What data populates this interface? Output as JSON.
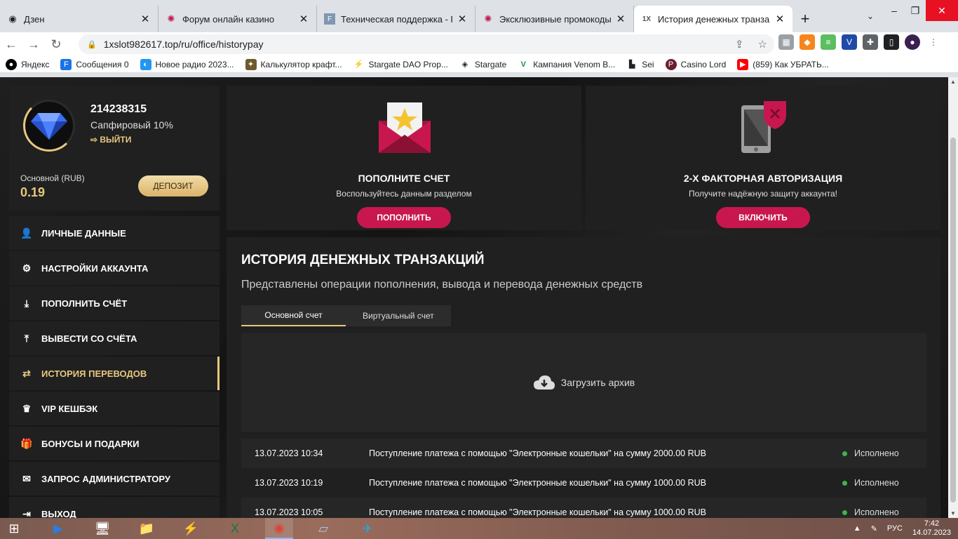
{
  "browser": {
    "tabs": [
      {
        "title": "Дзен",
        "icon": "dzen-icon"
      },
      {
        "title": "Форум онлайн казино",
        "icon": "forum-icon"
      },
      {
        "title": "Техническая поддержка - Flat",
        "icon": "support-icon"
      },
      {
        "title": "Эксклюзивные промокоды на",
        "icon": "promo-icon"
      },
      {
        "title": "История денежных транзакций",
        "icon": "1x-icon"
      }
    ],
    "url": "1xslot982617.top/ru/office/historypay",
    "bookmarks": [
      "Яндекс",
      "Сообщения 0",
      "Новое радио 2023...",
      "Калькулятор крафт...",
      "Stargate DAO Prop...",
      "Stargate",
      "Кампания Venom B...",
      "Sei",
      "Casino Lord",
      "(859) Как УБРАТЬ..."
    ]
  },
  "profile": {
    "id": "214238315",
    "level": "Сапфировый 10%",
    "logout": "ВЫЙТИ",
    "balance_label": "Основной (RUB)",
    "balance": "0.19",
    "deposit_button": "ДЕПОЗИТ"
  },
  "menu": [
    {
      "label": "ЛИЧНЫЕ ДАННЫЕ",
      "icon": "user-add-icon"
    },
    {
      "label": "НАСТРОЙКИ АККАУНТА",
      "icon": "gears-icon"
    },
    {
      "label": "ПОПОЛНИТЬ СЧЁТ",
      "icon": "download-icon"
    },
    {
      "label": "ВЫВЕСТИ СО СЧЁТА",
      "icon": "upload-icon"
    },
    {
      "label": "ИСТОРИЯ ПЕРЕВОДОВ",
      "icon": "transfer-icon"
    },
    {
      "label": "VIP КЕШБЭК",
      "icon": "crown-icon"
    },
    {
      "label": "БОНУСЫ И ПОДАРКИ",
      "icon": "gift-icon"
    },
    {
      "label": "ЗАПРОС АДМИНИСТРАТОРУ",
      "icon": "mail-icon"
    },
    {
      "label": "ВЫХОД",
      "icon": "exit-icon"
    }
  ],
  "cards": {
    "deposit": {
      "title": "ПОПОЛНИТЕ СЧЕТ",
      "subtitle": "Воспользуйтесь данным разделом",
      "button": "ПОПОЛНИТЬ"
    },
    "twofa": {
      "title": "2-Х ФАКТОРНАЯ АВТОРИЗАЦИЯ",
      "subtitle": "Получите надёжную защиту аккаунта!",
      "button": "ВКЛЮЧИТЬ"
    }
  },
  "history": {
    "title": "ИСТОРИЯ ДЕНЕЖНЫХ ТРАНЗАКЦИЙ",
    "subtitle": "Представлены операции пополнения, вывода и перевода денежных средств",
    "tabs": [
      "Основной счет",
      "Виртуальный счет"
    ],
    "archive": "Загрузить архив",
    "rows": [
      {
        "date": "13.07.2023 10:34",
        "desc": "Поступление платежа с помощью \"Электронные кошельки\" на сумму 2000.00 RUB",
        "status": "Исполнено"
      },
      {
        "date": "13.07.2023 10:19",
        "desc": "Поступление платежа с помощью \"Электронные кошельки\" на сумму 1000.00 RUB",
        "status": "Исполнено"
      },
      {
        "date": "13.07.2023 10:05",
        "desc": "Поступление платежа с помощью \"Электронные кошельки\" на сумму 1000.00 RUB",
        "status": "Исполнено"
      }
    ]
  },
  "taskbar": {
    "lang": "РУС",
    "time": "7:42",
    "date": "14.07.2023"
  },
  "colors": {
    "accent": "#e8c87f",
    "button": "#c8174e",
    "status_ok": "#3bb54a"
  }
}
